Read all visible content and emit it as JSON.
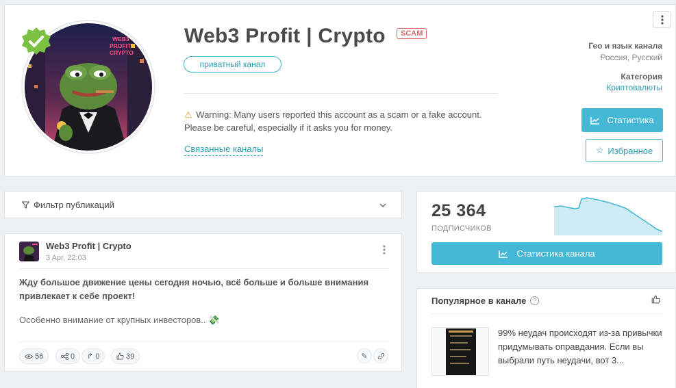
{
  "channel": {
    "title": "Web3 Profit | Crypto",
    "scam_label": "SCAM",
    "private_label": "приватный канал",
    "warning_line1": "Warning: Many users reported this account as a scam or a fake account.",
    "warning_line2": "Please be careful, especially if it asks you for money.",
    "related_label": "Связанные каналы",
    "geo_label": "Гео и язык канала",
    "geo_value": "Россия, Русский",
    "category_label": "Категория",
    "category_value": "Криптовалюты",
    "stats_button": "Статистика",
    "favorite_button": "Избранное",
    "avatar_text": [
      "WEB3",
      "PROFIT",
      "CRYPTO"
    ]
  },
  "filter": {
    "label": "Фильтр публикаций"
  },
  "post": {
    "author": "Web3 Profit | Crypto",
    "date": "3 Apr, 22:03",
    "text1": "Жду большое движение цены сегодня ночью, всё больше и больше внимания привлекает к себе проект!",
    "text2": "Особенно внимание от крупных инвесторов.. 💸",
    "views": "56",
    "shares": "0",
    "forwards": "0",
    "reactions": "39"
  },
  "subscribers": {
    "count": "25 364",
    "label": "ПОДПИСЧИКОВ",
    "button": "Статистика канала"
  },
  "popular": {
    "title": "Популярное в канале",
    "item_text": "99% неудач происходят из-за привычки придумывать оправдания. Если вы выбрали путь неудачи, вот 3..."
  },
  "colors": {
    "accent": "#45b8d6",
    "scam": "#e06767",
    "link": "#2aa1b5"
  }
}
